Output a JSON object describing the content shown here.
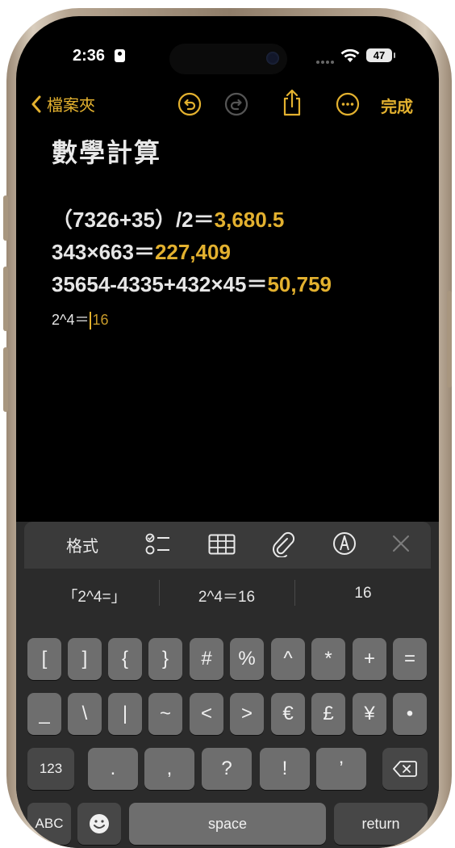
{
  "status_bar": {
    "time": "2:36",
    "battery": "47"
  },
  "toolbar": {
    "back_label": "檔案夾",
    "done_label": "完成"
  },
  "note": {
    "title": "數學計算",
    "lines": [
      {
        "expr": "（7326+35）/2＝",
        "result": "3,680.5"
      },
      {
        "expr": "343×663＝",
        "result": "227,409"
      },
      {
        "expr": "35654-4335+432×45＝",
        "result": "50,759"
      },
      {
        "expr": "2^4＝",
        "result": "16"
      }
    ]
  },
  "format_bar": {
    "format_label": "格式"
  },
  "suggestions": [
    "「2^4=」",
    "2^4＝16",
    "16"
  ],
  "keyboard": {
    "row1": [
      "[",
      "]",
      "{",
      "}",
      "#",
      "%",
      "^",
      "*",
      "+",
      "="
    ],
    "row2": [
      "_",
      "\\",
      "|",
      "~",
      "<",
      ">",
      "€",
      "£",
      "¥",
      "•"
    ],
    "row3": {
      "mode": "123",
      "keys": [
        ".",
        ",",
        "?",
        "!",
        "’"
      ]
    },
    "row4": {
      "abc": "ABC",
      "space": "space",
      "return": "return"
    }
  },
  "colors": {
    "accent": "#e3b12f",
    "background": "#000000"
  }
}
